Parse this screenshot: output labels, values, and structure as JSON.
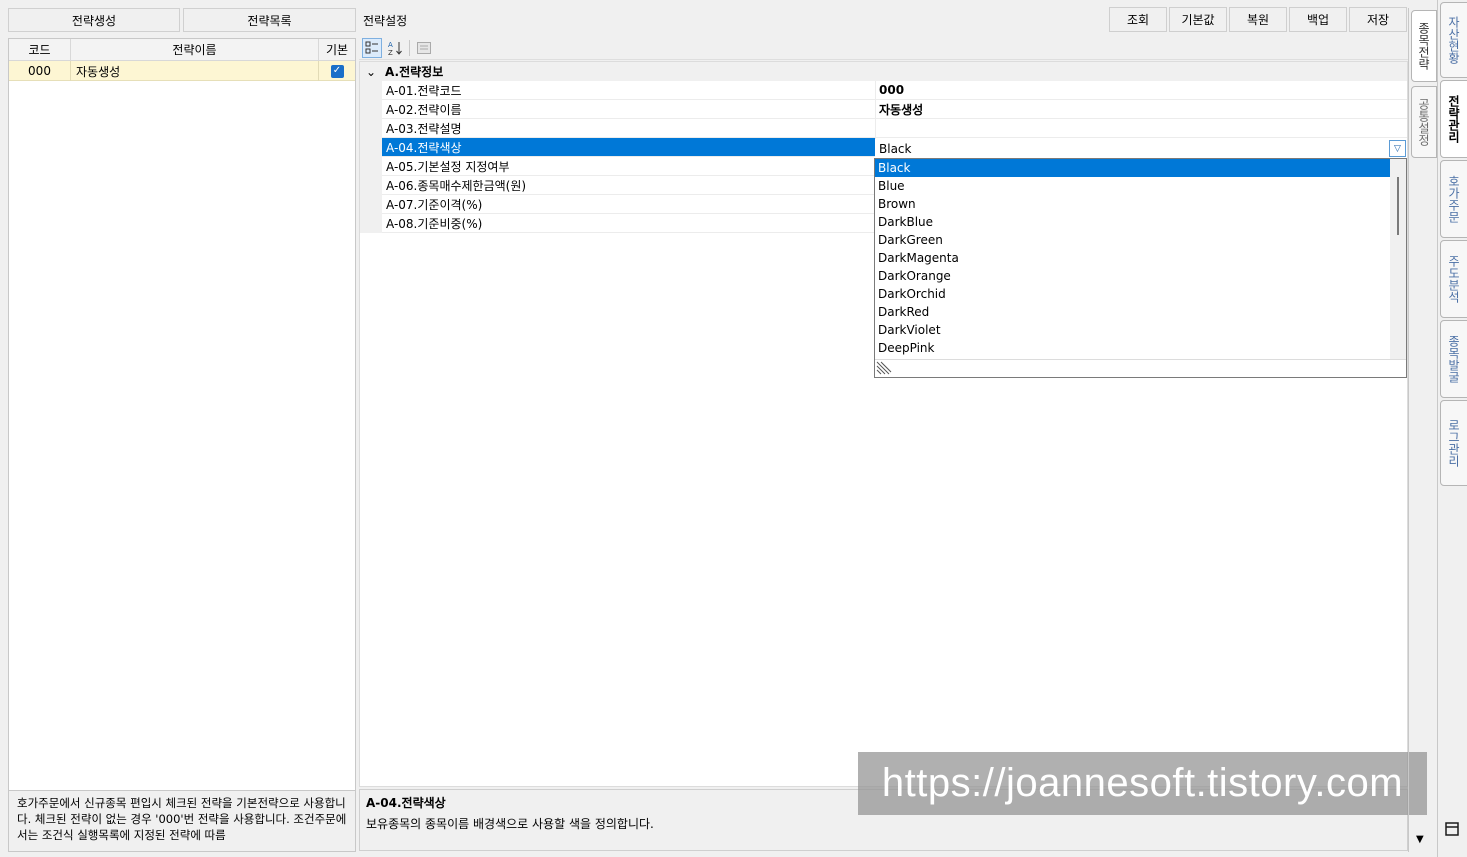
{
  "left": {
    "buttons": {
      "create": "전략생성",
      "list": "전략목록"
    },
    "columns": {
      "code": "코드",
      "name": "전략이름",
      "default": "기본"
    },
    "rows": [
      {
        "code": "000",
        "name": "자동생성",
        "default": true
      }
    ],
    "help": "호가주문에서 신규종목 편입시 체크된 전략을 기본전략으로 사용합니다. 체크된 전략이 없는 경우 '000'번 전략을 사용합니다. 조건주문에서는 조건식 실행목록에 지정된 전략에 따름"
  },
  "main": {
    "title": "전략설정",
    "actions": {
      "query": "조회",
      "default": "기본값",
      "restore": "복원",
      "backup": "백업",
      "save": "저장"
    },
    "toolbar": {
      "categorized_icon": "categorized-icon",
      "sort_az_icon": "sort-az-icon",
      "property_pages_icon": "property-pages-icon"
    },
    "category": {
      "expander": "⌄",
      "label": "A.전략정보"
    },
    "properties": [
      {
        "name": "A-01.전략코드",
        "value": "000"
      },
      {
        "name": "A-02.전략이름",
        "value": "자동생성"
      },
      {
        "name": "A-03.전략설명",
        "value": ""
      },
      {
        "name": "A-04.전략색상",
        "value": "Black"
      },
      {
        "name": "A-05.기본설정 지정여부",
        "value": ""
      },
      {
        "name": "A-06.종목매수제한금액(원)",
        "value": ""
      },
      {
        "name": "A-07.기준이격(%)",
        "value": ""
      },
      {
        "name": "A-08.기준비중(%)",
        "value": ""
      }
    ],
    "dropdown": {
      "current": "Black",
      "options": [
        "Black",
        "Blue",
        "Brown",
        "DarkBlue",
        "DarkGreen",
        "DarkMagenta",
        "DarkOrange",
        "DarkOrchid",
        "DarkRed",
        "DarkViolet",
        "DeepPink"
      ],
      "selected": "Black"
    },
    "help": {
      "title": "A-04.전략색상",
      "description": "보유종목의 종목이름 배경색으로 사용할 색을 정의합니다."
    }
  },
  "tabs": {
    "inner": [
      "종목전략",
      "공통설정"
    ],
    "outer": [
      "자산현황",
      "전략관리",
      "호가주문",
      "주도분석",
      "종목발굴",
      "로그관리"
    ],
    "active_outer": "전략관리"
  },
  "watermark": "https://joannesoft.tistory.com",
  "colors": {
    "accent": "#0078d7",
    "row_highlight": "#fdf6d3",
    "tab_text": "#4a6fa5"
  }
}
